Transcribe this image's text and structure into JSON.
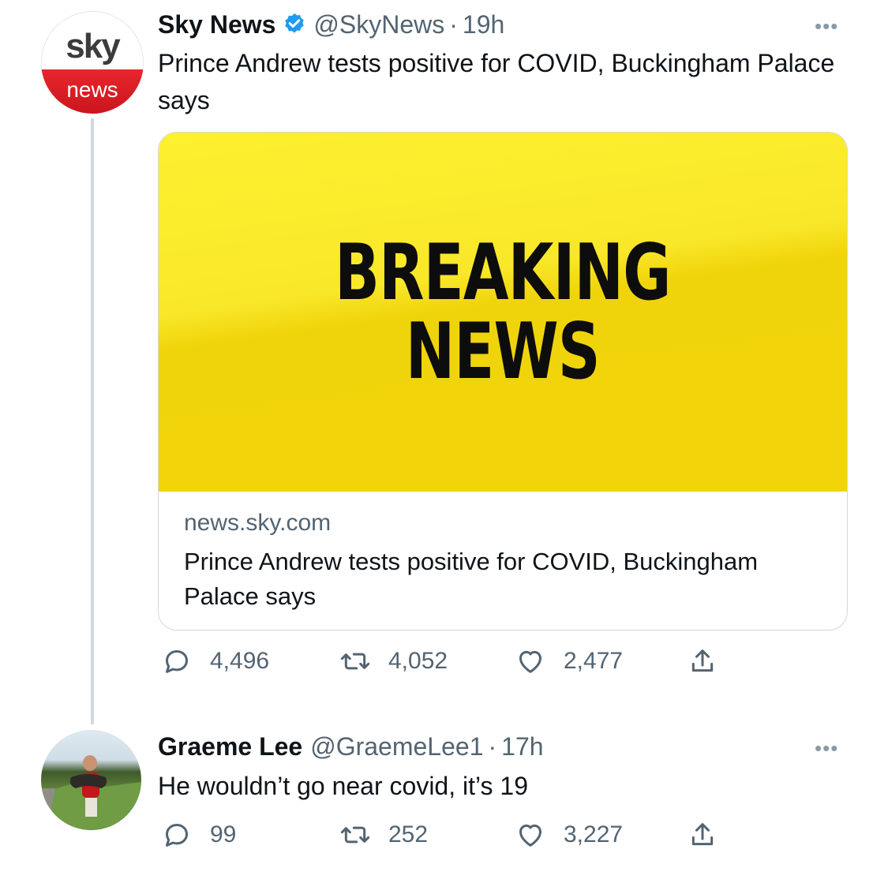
{
  "tweet": {
    "avatar": {
      "top": "sky",
      "bottom": "news"
    },
    "name": "Sky News",
    "handle": "@SkyNews",
    "separator": "·",
    "time": "19h",
    "more_label": "•••",
    "text": "Prince Andrew tests positive for COVID, Buckingham Palace says",
    "card": {
      "image_lines": [
        "BREAKING",
        "NEWS"
      ],
      "domain": "news.sky.com",
      "title": "Prince Andrew tests positive for COVID, Buckingham Palace says"
    },
    "actions": {
      "replies": "4,496",
      "retweets": "4,052",
      "likes": "2,477"
    }
  },
  "reply": {
    "name": "Graeme Lee",
    "handle": "@GraemeLee1",
    "separator": "·",
    "time": "17h",
    "more_label": "•••",
    "text": "He wouldn’t go near covid, it’s 19",
    "actions": {
      "replies": "99",
      "retweets": "252",
      "likes": "3,227"
    }
  },
  "colors": {
    "verified": "#1d9bf0",
    "secondary_text": "#536471",
    "breaking_yellow": "#f5dc14",
    "sky_red": "#e1232b"
  }
}
